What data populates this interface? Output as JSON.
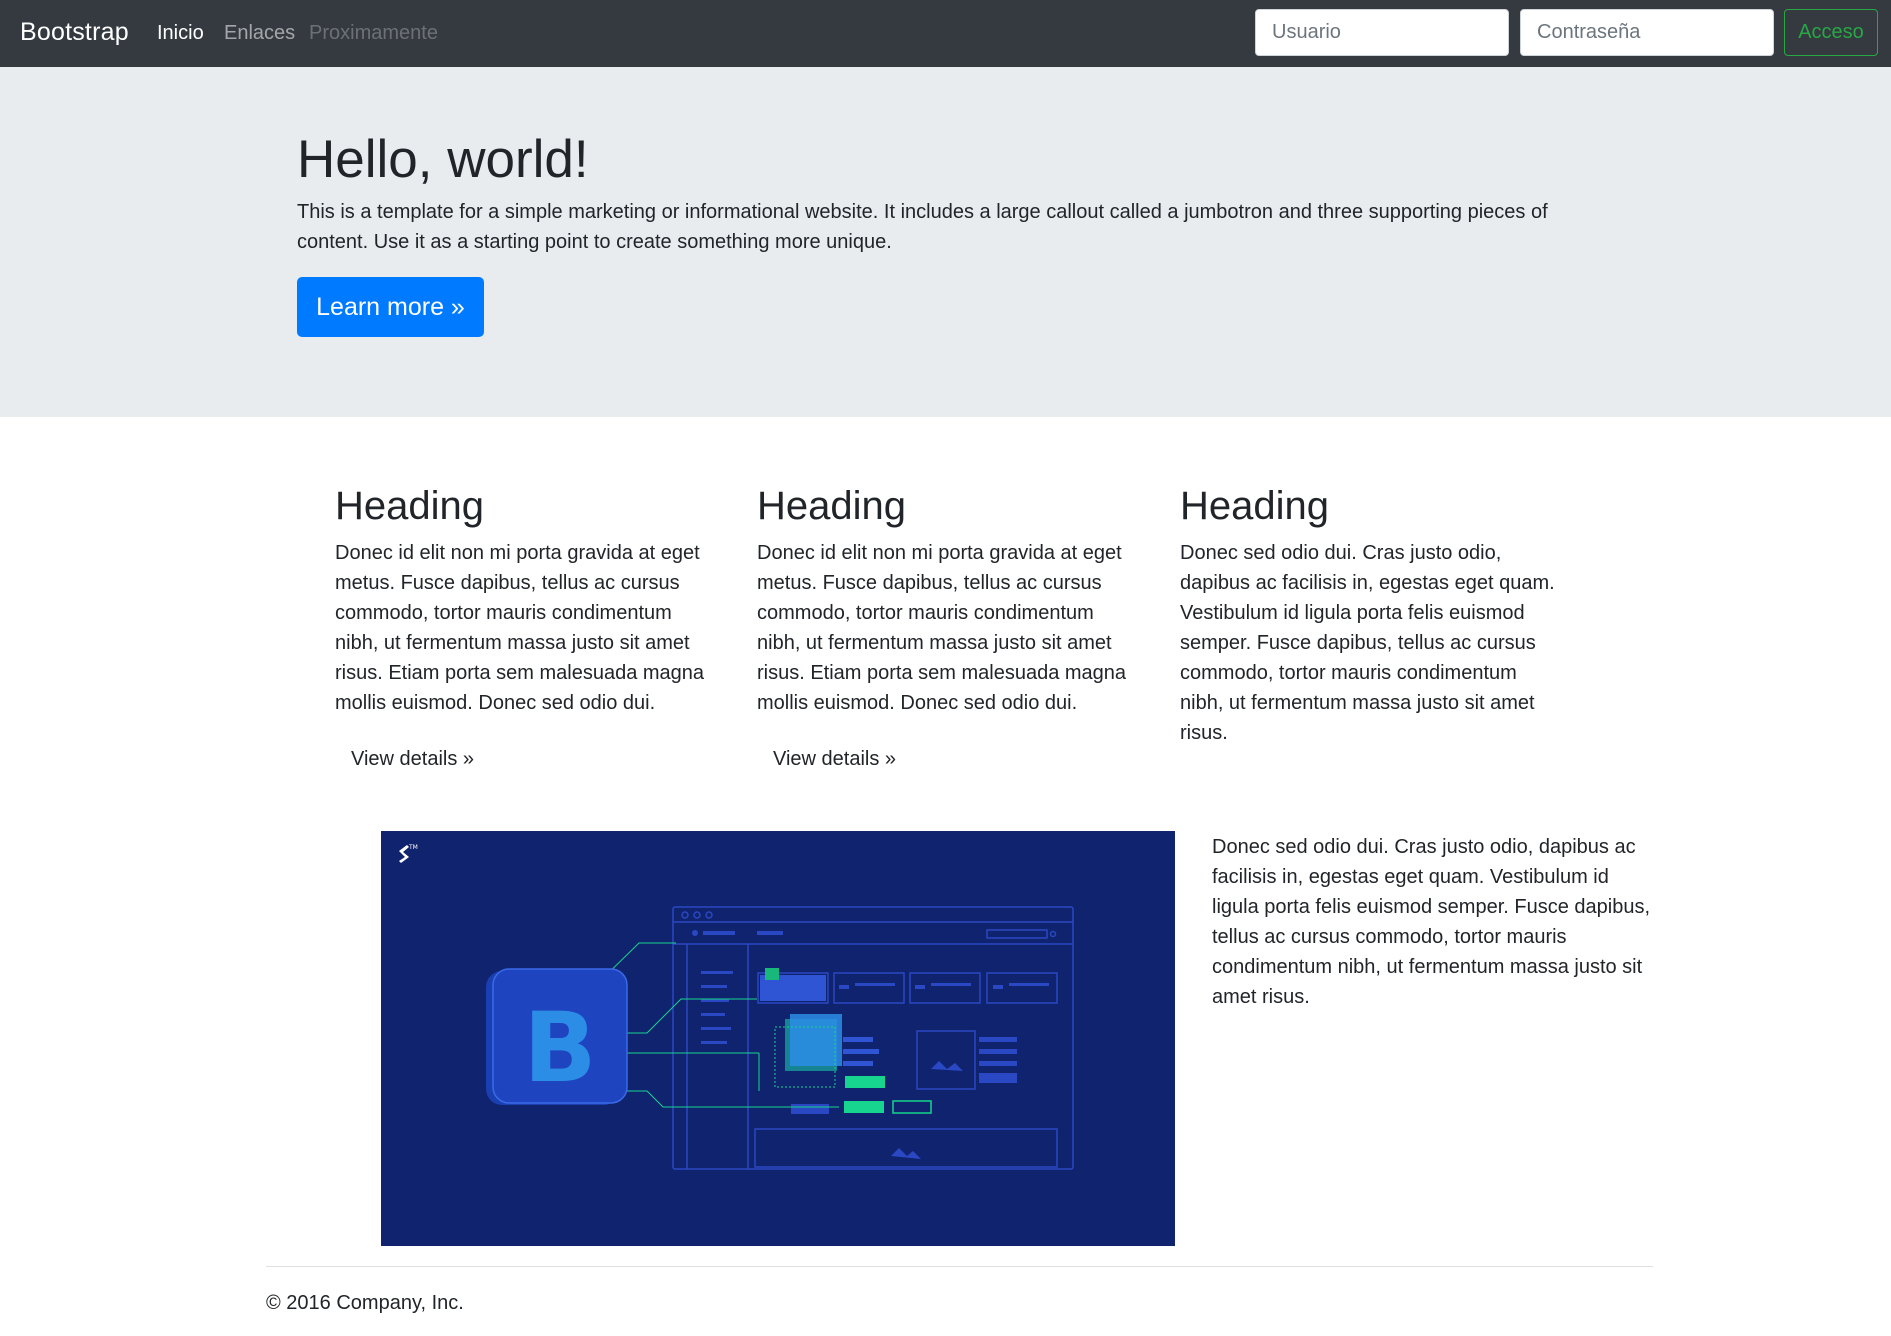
{
  "navbar": {
    "brand": "Bootstrap",
    "links": [
      {
        "label": "Inicio",
        "state": "active"
      },
      {
        "label": "Enlaces",
        "state": "normal"
      },
      {
        "label": "Proximamente",
        "state": "disabled"
      }
    ],
    "username_placeholder": "Usuario",
    "password_placeholder": "Contraseña",
    "login_label": "Acceso"
  },
  "jumbotron": {
    "title": "Hello, world!",
    "text": "This is a template for a simple marketing or informational website. It includes a large callout called a jumbotron and three supporting pieces of content. Use it as a starting point to create something more unique.",
    "button_label": "Learn more »"
  },
  "columns": [
    {
      "heading": "Heading",
      "text": "Donec id elit non mi porta gravida at eget metus. Fusce dapibus, tellus ac cursus commodo, tortor mauris condimentum nibh, ut fermentum massa justo sit amet risus. Etiam porta sem malesuada magna mollis euismod. Donec sed odio dui.",
      "button_label": "View details »"
    },
    {
      "heading": "Heading",
      "text": "Donec id elit non mi porta gravida at eget metus. Fusce dapibus, tellus ac cursus commodo, tortor mauris condimentum nibh, ut fermentum massa justo sit amet risus. Etiam porta sem malesuada magna mollis euismod. Donec sed odio dui.",
      "button_label": "View details »"
    },
    {
      "heading": "Heading",
      "text": "Donec sed odio dui. Cras justo odio, dapibus ac facilisis in, egestas eget quam. Vestibulum id ligula porta felis euismod semper. Fusce dapibus, tellus ac cursus commodo, tortor mauris condimentum nibh, ut fermentum massa justo sit amet risus."
    }
  ],
  "feature": {
    "image_letter": "B",
    "text": "Donec sed odio dui. Cras justo odio, dapibus ac facilisis in, egestas eget quam. Vestibulum id ligula porta felis euismod semper. Fusce dapibus, tellus ac cursus commodo, tortor mauris condimentum nibh, ut fermentum massa justo sit amet risus."
  },
  "footer": {
    "text": "© 2016 Company, Inc."
  },
  "colors": {
    "navbar_bg": "#343a40",
    "jumbotron_bg": "#e9ecef",
    "primary": "#007bff",
    "success": "#28a745",
    "image_bg": "#10236e",
    "bootstrap_blue": "#2c8de6",
    "accent_green": "#17d58e"
  }
}
